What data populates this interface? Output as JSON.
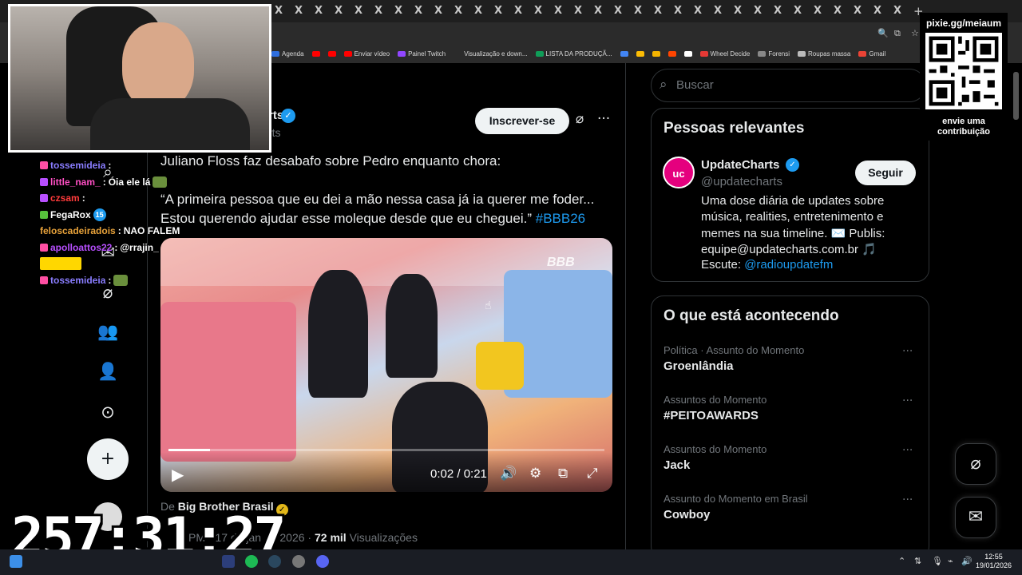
{
  "browser": {
    "tab_close_glyph": "X",
    "new_tab": "+",
    "bookmarks": [
      {
        "label": "Agenda",
        "color": "#2f6fdf"
      },
      {
        "label": "",
        "color": "#ff0000"
      },
      {
        "label": "",
        "color": "#ff0000"
      },
      {
        "label": "Enviar vídeo",
        "color": "#ff0000"
      },
      {
        "label": "Painel Twitch",
        "color": "#9146ff"
      },
      {
        "label": "Visualização e down...",
        "color": "#2b2b2b"
      },
      {
        "label": "LISTA DA PRODUÇÃ...",
        "color": "#0f9d58"
      },
      {
        "label": "",
        "color": "#4285f4"
      },
      {
        "label": "",
        "color": "#fbbc05"
      },
      {
        "label": "",
        "color": "#f4b400"
      },
      {
        "label": "",
        "color": "#ff4500"
      },
      {
        "label": "",
        "color": "#ffffff"
      },
      {
        "label": "Wheel Decide",
        "color": "#e53935"
      },
      {
        "label": "Forensi",
        "color": "#888888"
      },
      {
        "label": "Roupas massa",
        "color": "#bbbbbb"
      },
      {
        "label": "Gmail",
        "color": "#ea4335"
      }
    ]
  },
  "nav": {
    "icons": [
      "search-icon",
      "messages-icon",
      "grok-icon",
      "communities-icon",
      "profile-icon",
      "more-icon"
    ],
    "post_glyph": "+"
  },
  "tweet": {
    "author_fragment": "rts",
    "handle_fragment": "rts",
    "subscribe_label": "Inscrever-se",
    "line1": "Juliano Floss faz desabafo sobre Pedro enquanto chora:",
    "line2": "“A primeira pessoa que eu dei a mão nessa casa já ia querer me foder...",
    "line3": "Estou querendo ajudar esse moleque desde que eu cheguei.”",
    "hashtag": "#BBB26",
    "video": {
      "time": "0:02 / 0:21",
      "progress": 0.095,
      "watermark": "BBB"
    },
    "from_prefix": "De",
    "from_name": "Big Brother Brasil",
    "meta_date": "PM · 17 de jan de 2026 · ",
    "meta_views_count": "72 mil",
    "meta_views_label": " Visualizações"
  },
  "sidebar": {
    "search_placeholder": "Buscar",
    "people": {
      "title": "Pessoas relevantes",
      "avatar_text": "uc",
      "name": "UpdateCharts",
      "handle": "@updatecharts",
      "follow_label": "Seguir",
      "bio": [
        "Uma dose diária de updates sobre",
        "música, realities, entretenimento e",
        "memes na sua timeline. ✉️ Publis:",
        "equipe@updatecharts.com.br 🎵"
      ],
      "bio_listen_prefix": "Escute: ",
      "bio_listen_link": "@radioupdatefm"
    },
    "trends": {
      "title": "O que está acontecendo",
      "items": [
        {
          "category": "Política · Assunto do Momento",
          "name": "Groenlândia"
        },
        {
          "category": "Assuntos do Momento",
          "name": "#PEITOAWARDS"
        },
        {
          "category": "Assuntos do Momento",
          "name": "Jack"
        },
        {
          "category": "Assunto do Momento em Brasil",
          "name": "Cowboy"
        }
      ],
      "more_glyph": "···"
    }
  },
  "stream": {
    "chat": [
      {
        "user": "tossemideia",
        "color": "#8a7dff",
        "message": "",
        "badge": "#ff4fa3"
      },
      {
        "user": "little_nam_",
        "color": "#ff4fc4",
        "message": "Óia ele lá",
        "badge": "#b84fff"
      },
      {
        "user": "czsam",
        "color": "#ff3b3b",
        "message": "",
        "badge": "#b84fff"
      },
      {
        "user": "FegaRox",
        "color": "#ffffff",
        "message": "",
        "badge": "#56c13c"
      },
      {
        "user": "feloscadeiradois",
        "color": "#e8a23a",
        "message": "NAO FALEM",
        "badge": ""
      },
      {
        "user": "apolloattos22",
        "color": "#b84fff",
        "message": "@rrajin_",
        "badge": "#ff4fa3"
      },
      {
        "user": "",
        "color": "#ffffff",
        "message": "",
        "badge": "#ffd700"
      },
      {
        "user": "tossemideia",
        "color": "#8a7dff",
        "message": "",
        "badge": "#ff4fa3"
      }
    ],
    "chat_badge_count": "15",
    "timer": "257:31:27",
    "qr_url": "pixie.gg/meiaum",
    "qr_caption_1": "envie uma",
    "qr_caption_2": "contribuição"
  },
  "taskbar": {
    "time": "12:55",
    "date": "19/01/2026"
  },
  "colors": {
    "accent": "#1d9bf0",
    "background": "#000000",
    "border": "#2f3336",
    "muted_text": "#71767b"
  }
}
